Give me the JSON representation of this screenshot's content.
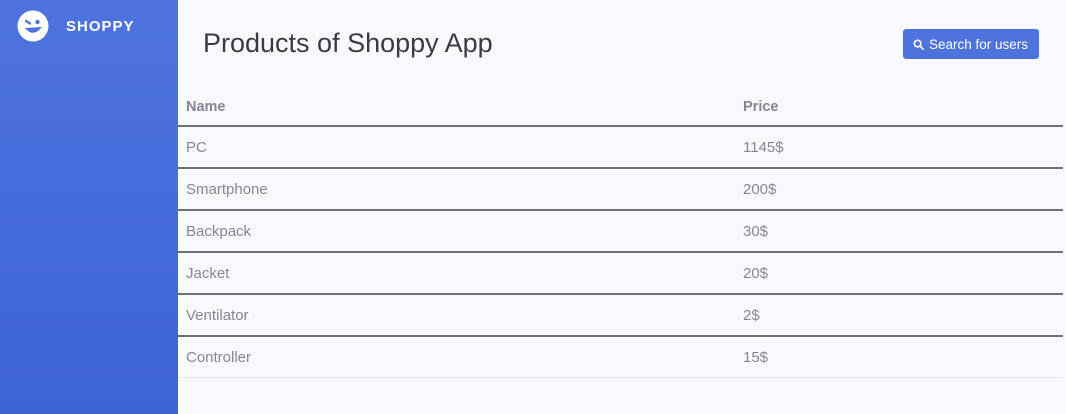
{
  "sidebar": {
    "brand": {
      "name": "SHOPPY",
      "icon": "winking-face-icon"
    }
  },
  "header": {
    "title": "Products of Shoppy App",
    "search_button": {
      "label": "Search for users",
      "icon": "search-icon"
    }
  },
  "table": {
    "columns": [
      "Name",
      "Price"
    ],
    "rows": [
      {
        "name": "PC",
        "price": "1145$"
      },
      {
        "name": "Smartphone",
        "price": "200$"
      },
      {
        "name": "Backpack",
        "price": "30$"
      },
      {
        "name": "Jacket",
        "price": "20$"
      },
      {
        "name": "Ventilator",
        "price": "2$"
      },
      {
        "name": "Controller",
        "price": "15$"
      }
    ]
  },
  "colors": {
    "accent": "#4e73df",
    "text": "#858796",
    "heading": "#3a3b45",
    "background": "#f8f9fc"
  }
}
